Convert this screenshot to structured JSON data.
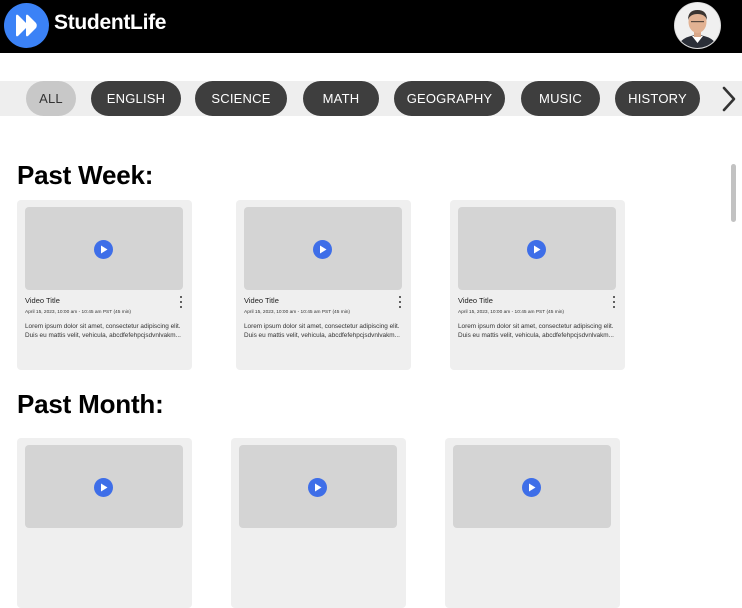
{
  "header": {
    "app_title": "StudentLife",
    "logo_icon": "fast-forward-icon",
    "brand_color": "#3b82f6"
  },
  "categories": [
    "ALL",
    "ENGLISH",
    "SCIENCE",
    "MATH",
    "GEOGRAPHY",
    "MUSIC",
    "HISTORY"
  ],
  "active_category": "ALL",
  "sections": [
    {
      "title": "Past Week:",
      "videos": [
        {
          "title": "Video Title",
          "meta": "April 15, 2023, 10:00 am - 10:45 am PST  (45 min)",
          "description": "Lorem ipsum dolor sit amet, consectetur adipiscing elit. Duis eu mattis velit, vehicula, abcdfefehpcjsdvnlvakm..."
        },
        {
          "title": "Video Title",
          "meta": "April 15, 2023, 10:00 am - 10:45 am PST  (45 min)",
          "description": "Lorem ipsum dolor sit amet, consectetur adipiscing elit. Duis eu mattis velit, vehicula, abcdfefehpcjsdvnlvakm..."
        },
        {
          "title": "Video Title",
          "meta": "April 15, 2023, 10:00 am - 10:45 am PST  (45 min)",
          "description": "Lorem ipsum dolor sit amet, consectetur adipiscing elit. Duis eu mattis velit, vehicula, abcdfefehpcjsdvnlvakm..."
        }
      ]
    },
    {
      "title": "Past Month:",
      "videos": [
        {
          "title": "",
          "meta": "",
          "description": ""
        },
        {
          "title": "",
          "meta": "",
          "description": ""
        },
        {
          "title": "",
          "meta": "",
          "description": ""
        }
      ]
    }
  ]
}
